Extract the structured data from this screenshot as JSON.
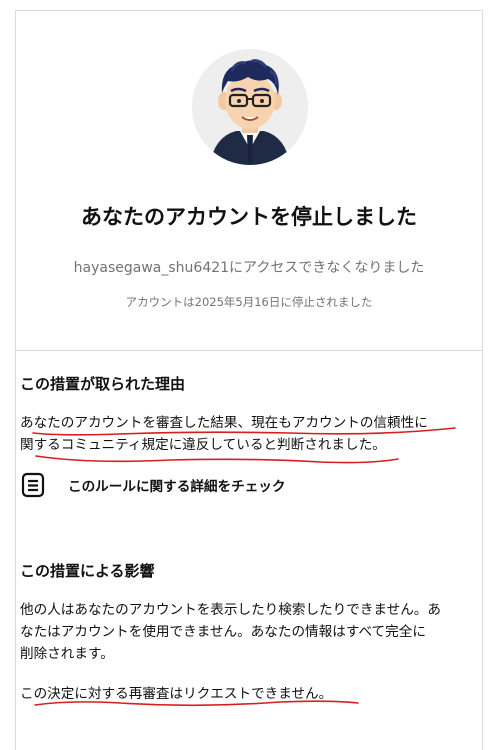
{
  "header": {
    "title": "あなたのアカウントを停止しました",
    "subtitle": "hayasegawa_shu6421にアクセスできなくなりました",
    "date_line": "アカウントは2025年5月16日に停止されました"
  },
  "reason": {
    "heading": "この措置が取られた理由",
    "line1": "あなたのアカウントを審査した結果、現在もアカウントの信頼性に",
    "line2": "関するコミュニティ規定に違反していると判断されました。",
    "link_label": "このルールに関する詳細をチェック",
    "link_icon": "document-icon"
  },
  "impact": {
    "heading": "この措置による影響",
    "line1": "他の人はあなたのアカウントを表示したり検索したりできません。あ",
    "line2": "なたはアカウントを使用できません。あなたの情報はすべて完全に",
    "line3": "削除されます。",
    "line4": "この決定に対する再審査はリクエストできません。"
  },
  "colors": {
    "annotation_red": "#d61f1f",
    "divider": "#dbdbdb",
    "muted_text": "#737373"
  }
}
